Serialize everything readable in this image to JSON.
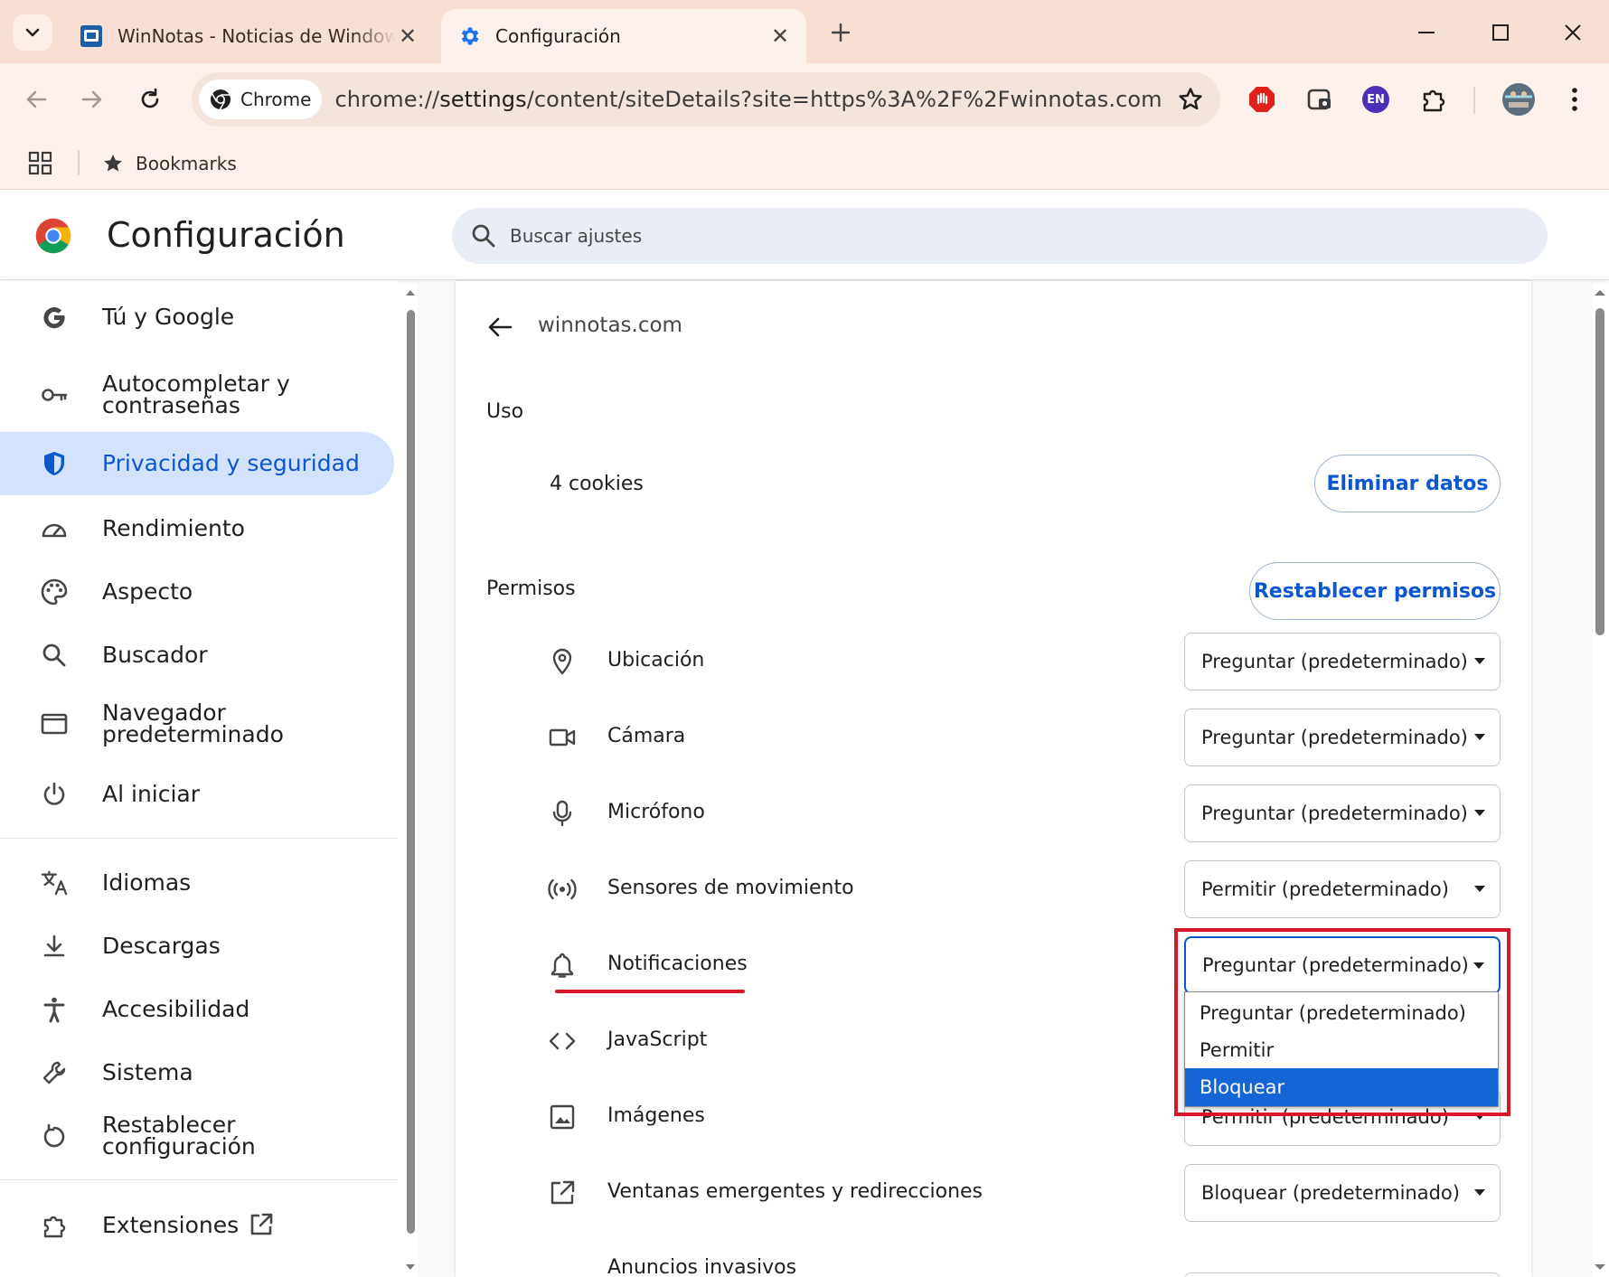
{
  "browser": {
    "tabs": [
      {
        "title": "WinNotas - Noticias de Windows",
        "active": false
      },
      {
        "title": "Configuración",
        "active": true
      }
    ],
    "omnibox": {
      "chip_label": "Chrome",
      "url_prefix": "chrome://",
      "url_host": "settings",
      "url_rest": "/content/siteDetails?site=https%3A%2F%2Fwinnotas.com"
    },
    "extensions": {
      "lang_badge": "EN"
    },
    "bookmarks": {
      "label": "Bookmarks"
    }
  },
  "settings": {
    "title": "Configuración",
    "search_placeholder": "Buscar ajustes",
    "sidebar": {
      "items": [
        {
          "label": "Tú y Google",
          "icon": "google-g-icon"
        },
        {
          "label": "Autocompletar y contraseñas",
          "icon": "key-icon"
        },
        {
          "label": "Privacidad y seguridad",
          "icon": "shield-icon",
          "active": true
        },
        {
          "label": "Rendimiento",
          "icon": "speedometer-icon"
        },
        {
          "label": "Aspecto",
          "icon": "palette-icon"
        },
        {
          "label": "Buscador",
          "icon": "search-icon"
        },
        {
          "label": "Navegador predeterminado",
          "icon": "browser-window-icon"
        },
        {
          "label": "Al iniciar",
          "icon": "power-icon"
        },
        {
          "label": "Idiomas",
          "icon": "translate-icon"
        },
        {
          "label": "Descargas",
          "icon": "download-icon"
        },
        {
          "label": "Accesibilidad",
          "icon": "accessibility-icon"
        },
        {
          "label": "Sistema",
          "icon": "wrench-icon"
        },
        {
          "label": "Restablecer configuración",
          "icon": "reset-icon"
        },
        {
          "label": "Extensiones",
          "icon": "puzzle-icon"
        }
      ]
    },
    "site": {
      "name": "winnotas.com",
      "usage_label": "Uso",
      "cookies_text": "4 cookies",
      "delete_button": "Eliminar datos",
      "permissions_label": "Permisos",
      "reset_button": "Restablecer permisos",
      "permissions": [
        {
          "label": "Ubicación",
          "icon": "location-pin-icon",
          "value": "Preguntar (predeterminado)"
        },
        {
          "label": "Cámara",
          "icon": "camera-icon",
          "value": "Preguntar (predeterminado)"
        },
        {
          "label": "Micrófono",
          "icon": "microphone-icon",
          "value": "Preguntar (predeterminado)"
        },
        {
          "label": "Sensores de movimiento",
          "icon": "motion-sensor-icon",
          "value": "Permitir (predeterminado)"
        },
        {
          "label": "Notificaciones",
          "icon": "bell-icon",
          "value": "Preguntar (predeterminado)"
        },
        {
          "label": "JavaScript",
          "icon": "code-icon",
          "value": ""
        },
        {
          "label": "Imágenes",
          "icon": "image-icon",
          "value": "Permitir (predeterminado)"
        },
        {
          "label": "Ventanas emergentes y redirecciones",
          "icon": "external-link-icon",
          "value": "Bloquear (predeterminado)"
        },
        {
          "label": "Anuncios invasivos",
          "icon": "",
          "value": ""
        }
      ],
      "dropdown_options": [
        {
          "label": "Preguntar (predeterminado)",
          "selected": false
        },
        {
          "label": "Permitir",
          "selected": false
        },
        {
          "label": "Bloquear",
          "selected": true
        }
      ]
    }
  },
  "colors": {
    "accent": "#0b57d0",
    "active_nav_bg": "#d3e3fd",
    "highlight_red": "#d8182a",
    "tabstrip_bg": "#f7dfd3",
    "option_selected_bg": "#1565d6"
  }
}
